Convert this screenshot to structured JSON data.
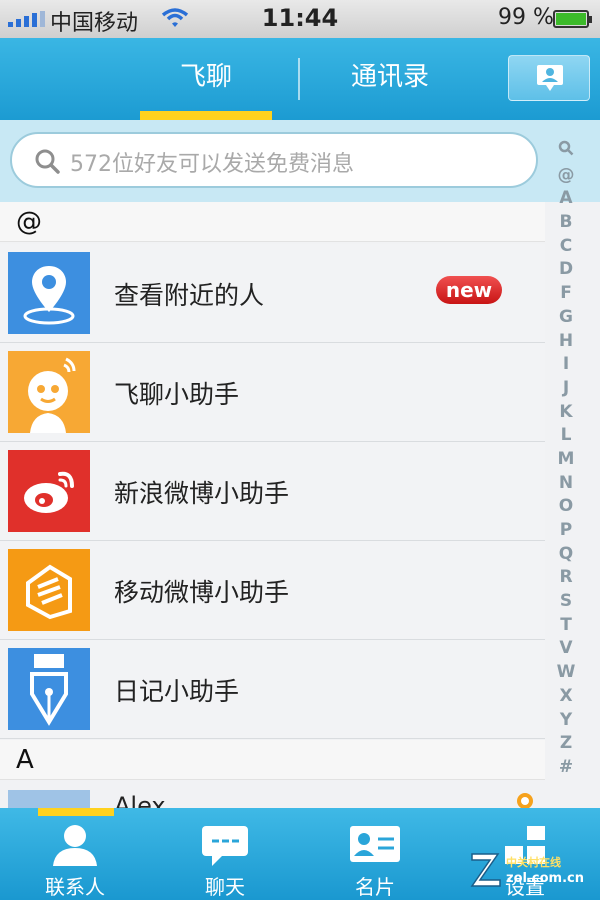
{
  "status_bar": {
    "carrier": "中国移动",
    "time": "11:44",
    "battery_percent": "99 %",
    "battery_level": 0.99
  },
  "header": {
    "tabs": [
      {
        "label": "飞聊",
        "active": true
      },
      {
        "label": "通讯录",
        "active": false
      }
    ],
    "right_button_icon": "contact-card-icon"
  },
  "search": {
    "placeholder": "572位好友可以发送免费消息"
  },
  "sections": [
    {
      "letter": "@"
    },
    {
      "letter": "A"
    }
  ],
  "rows": [
    {
      "label": "查看附近的人",
      "icon": "location-pin-icon",
      "badge": "new"
    },
    {
      "label": "飞聊小助手",
      "icon": "robot-icon"
    },
    {
      "label": "新浪微博小助手",
      "icon": "weibo-icon"
    },
    {
      "label": "移动微博小助手",
      "icon": "mobile-weibo-icon"
    },
    {
      "label": "日记小助手",
      "icon": "pen-nib-icon"
    }
  ],
  "partial_row": {
    "label": "Alex"
  },
  "index": [
    "Q",
    "@",
    "A",
    "B",
    "C",
    "D",
    "F",
    "G",
    "H",
    "I",
    "J",
    "K",
    "L",
    "M",
    "N",
    "O",
    "P",
    "Q",
    "R",
    "S",
    "T",
    "V",
    "W",
    "X",
    "Y",
    "Z",
    "#"
  ],
  "tabbar": [
    {
      "label": "联系人",
      "icon": "person-icon",
      "active": true
    },
    {
      "label": "聊天",
      "icon": "chat-bubble-icon",
      "active": false
    },
    {
      "label": "名片",
      "icon": "business-card-icon",
      "active": false
    },
    {
      "label": "设置",
      "icon": "settings-icon",
      "active": false
    }
  ],
  "watermark": {
    "line1": "中关村在线",
    "line2": "zol.com.cn"
  },
  "colors": {
    "header_blue": "#1c9bd2",
    "accent_yellow": "#ffd21e",
    "badge_red": "#d91e1e"
  }
}
